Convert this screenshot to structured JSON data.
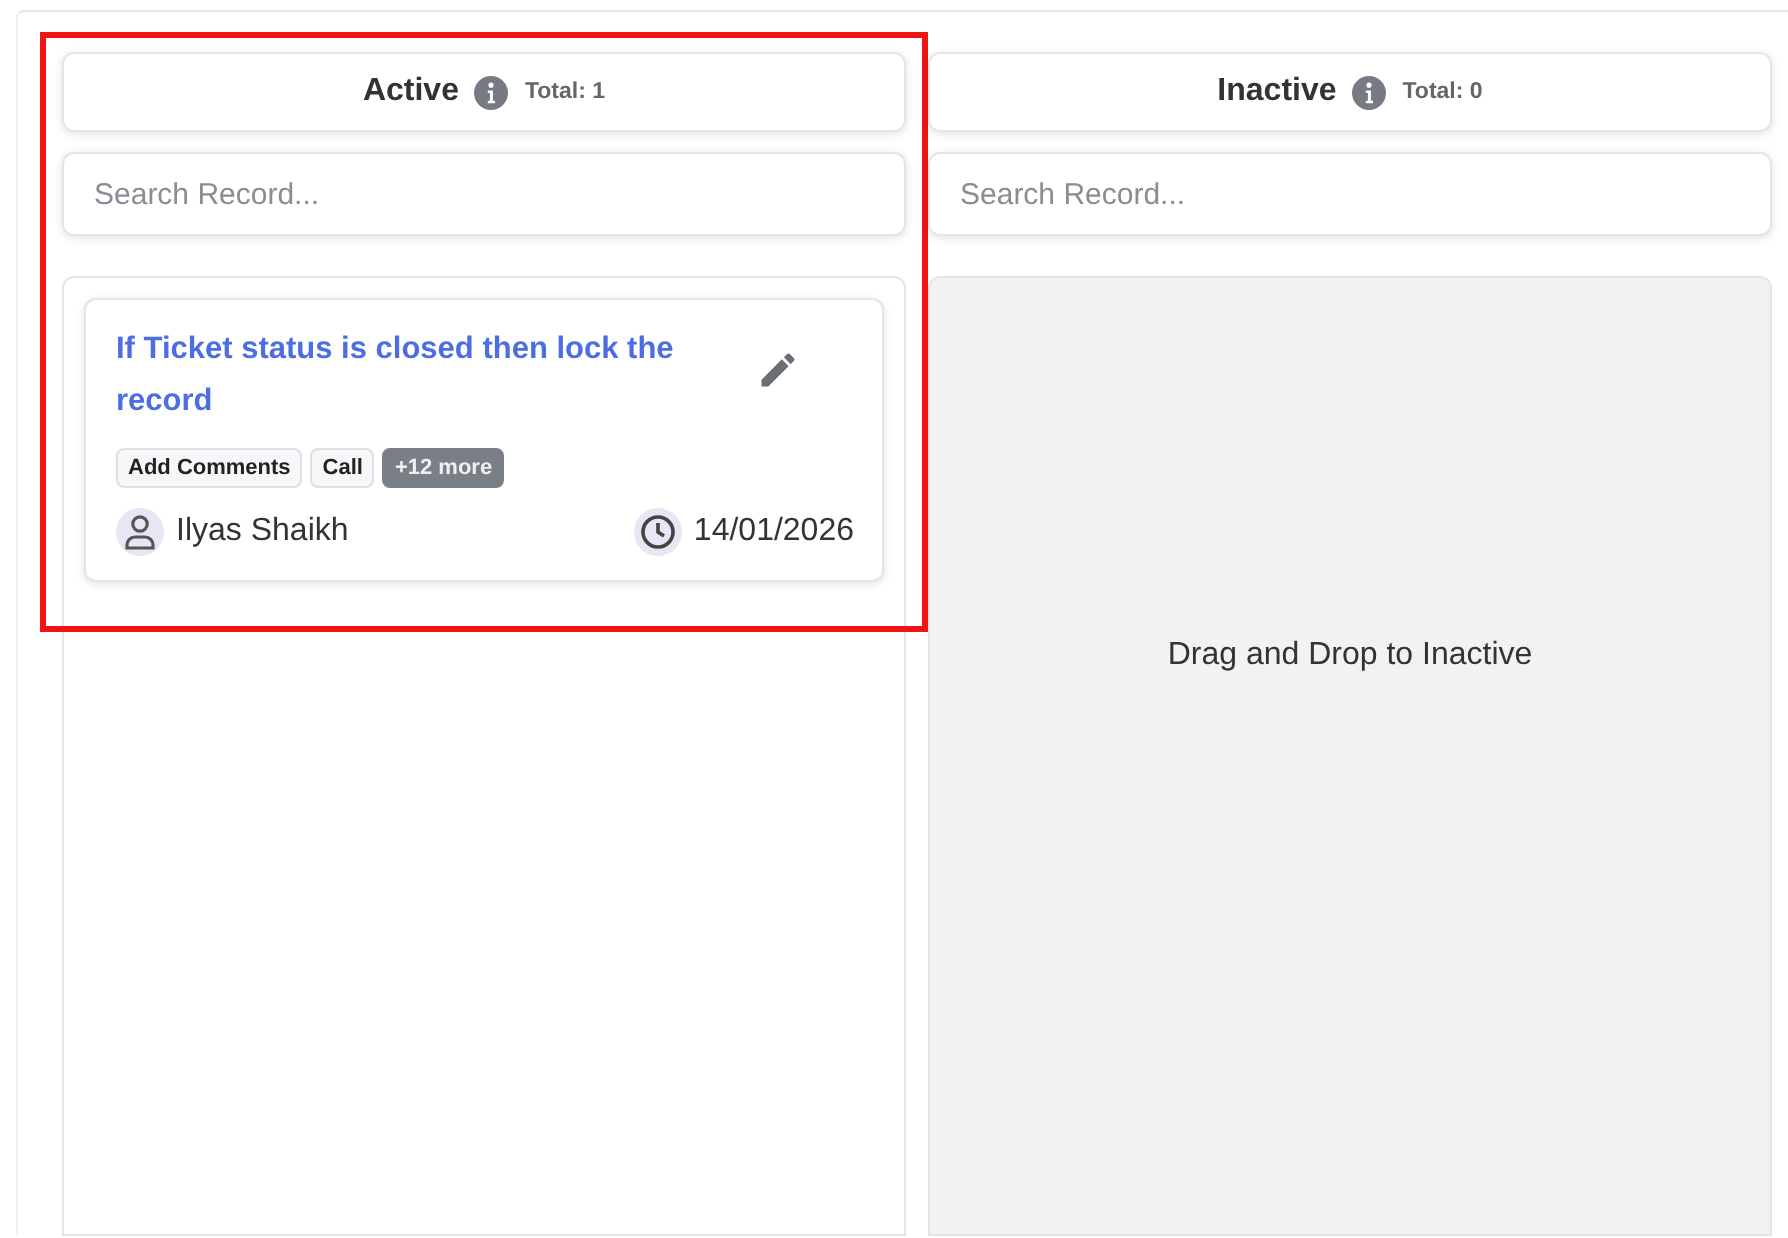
{
  "columns": [
    {
      "title": "Active",
      "total": "Total: 1",
      "search": {
        "placeholder": "Search Record..."
      },
      "highlighted": true,
      "cards": [
        {
          "title": "If Ticket status is closed then lock the record",
          "tags": [
            "Add Comments",
            "Call"
          ],
          "more": "+12 more",
          "owner": "Ilyas Shaikh",
          "date": "14/01/2026"
        }
      ]
    },
    {
      "title": "Inactive",
      "total": "Total: 0",
      "search": {
        "placeholder": "Search Record..."
      },
      "highlighted": false,
      "empty_text": "Drag and Drop to Inactive"
    }
  ]
}
